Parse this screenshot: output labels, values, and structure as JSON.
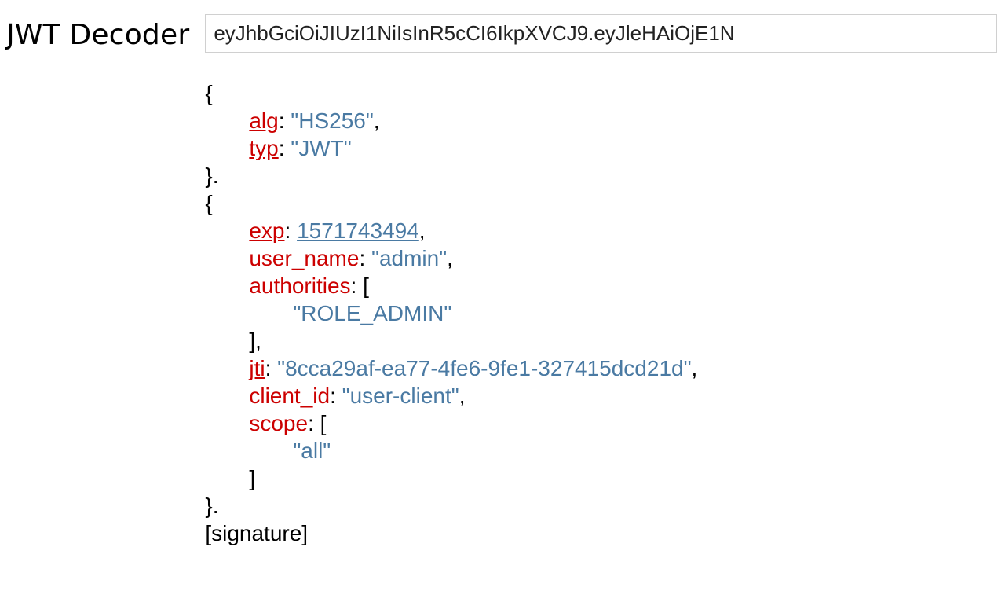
{
  "title": "JWT Decoder",
  "jwt_input": "eyJhbGciOiJIUzI1NiIsInR5cCI6IkpXVCJ9.eyJleHAiOjE1N",
  "header": {
    "keys": {
      "alg": "alg",
      "typ": "typ"
    },
    "values": {
      "alg": "\"HS256\"",
      "typ": "\"JWT\""
    }
  },
  "payload": {
    "keys": {
      "exp": "exp",
      "user_name": "user_name",
      "authorities": "authorities",
      "jti": "jti",
      "client_id": "client_id",
      "scope": "scope"
    },
    "values": {
      "exp": "1571743494",
      "user_name": "\"admin\"",
      "authorities_0": "\"ROLE_ADMIN\"",
      "jti": "\"8cca29af-ea77-4fe6-9fe1-327415dcd21d\"",
      "client_id": "\"user-client\"",
      "scope_0": "\"all\""
    }
  },
  "signature_label": "[signature]",
  "punct": {
    "open": "{",
    "close_dot": "}.",
    "close": "}",
    "colon_sp": ": ",
    "comma": ",",
    "arr_open": "[",
    "arr_close": "]",
    "arr_close_comma": "],"
  }
}
